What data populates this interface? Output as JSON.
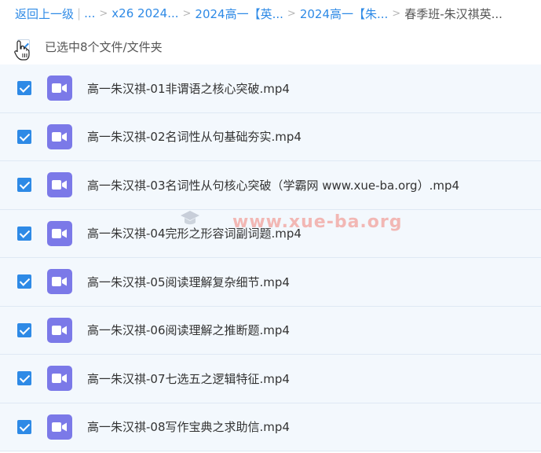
{
  "breadcrumb": {
    "back_label": "返回上一级",
    "ellipsis": "...",
    "items": [
      {
        "label": "x26 2024..."
      },
      {
        "label": "2024高一【英..."
      },
      {
        "label": "2024高一【朱..."
      }
    ],
    "current": "春季班-朱汉祺英..."
  },
  "selection": {
    "text": "已选中8个文件/文件夹"
  },
  "files": [
    {
      "name": "高一朱汉祺-01非谓语之核心突破.mp4",
      "checked": true
    },
    {
      "name": "高一朱汉祺-02名词性从句基础夯实.mp4",
      "checked": true
    },
    {
      "name": "高一朱汉祺-03名词性从句核心突破（学霸网 www.xue-ba.org）.mp4",
      "checked": true
    },
    {
      "name": "高一朱汉祺-04完形之形容词副词题.mp4",
      "checked": true
    },
    {
      "name": "高一朱汉祺-05阅读理解复杂细节.mp4",
      "checked": true
    },
    {
      "name": "高一朱汉祺-06阅读理解之推断题.mp4",
      "checked": true
    },
    {
      "name": "高一朱汉祺-07七选五之逻辑特征.mp4",
      "checked": true
    },
    {
      "name": "高一朱汉祺-08写作宝典之求助信.mp4",
      "checked": true
    }
  ],
  "watermark": "www.xue-ba.org",
  "colors": {
    "link": "#2e8ae6",
    "checkbox": "#2e8ae6",
    "video_icon": "#7b79e8",
    "row_bg": "#f3f8fd"
  },
  "icons": {
    "file_type": "video-icon",
    "cursor": "hand-pointer-icon"
  }
}
